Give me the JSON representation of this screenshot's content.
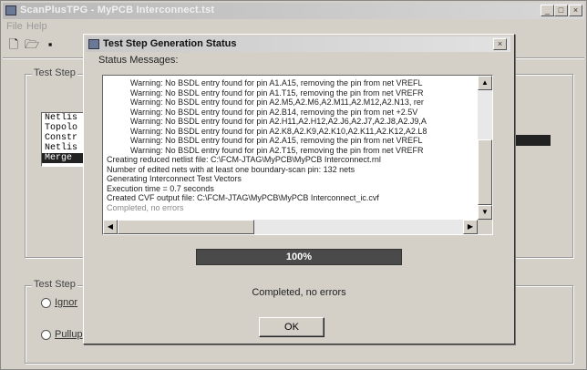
{
  "app": {
    "title": "ScanPlusTPG - MyPCB Interconnect.tst"
  },
  "menu": [
    "File",
    "Help"
  ],
  "toolbar": {
    "icons": [
      "new-icon",
      "open-icon",
      "save-icon"
    ]
  },
  "main": {
    "group1_label": "Test Step",
    "list_items": [
      "Netlis",
      "Topolo",
      "Constr",
      "Netlis",
      "Merge"
    ],
    "selected_index": 4,
    "group2_label": "Test Step",
    "radio1": "Ignor",
    "radio2": "Pullup"
  },
  "dialog": {
    "title": "Test Step Generation Status",
    "status_label": "Status Messages:",
    "messages": [
      {
        "text": "Warning: No BSDL entry found for pin A1.A15, removing the pin from net VREFL",
        "indent": true
      },
      {
        "text": "Warning: No BSDL entry found for pin A1.T15, removing the pin from net VREFR",
        "indent": true
      },
      {
        "text": "Warning: No BSDL entry found for pin A2.M5,A2.M6,A2.M11,A2.M12,A2.N13, rer",
        "indent": true
      },
      {
        "text": "Warning: No BSDL entry found for pin A2.B14, removing the pin from net +2.5V",
        "indent": true
      },
      {
        "text": "Warning: No BSDL entry found for pin A2.H11,A2.H12,A2.J6,A2.J7,A2.J8,A2.J9,A",
        "indent": true
      },
      {
        "text": "Warning: No BSDL entry found for pin A2.K8,A2.K9,A2.K10,A2.K11,A2.K12,A2.L8",
        "indent": true
      },
      {
        "text": "Warning: No BSDL entry found for pin A2.A15, removing the pin from net VREFL",
        "indent": true
      },
      {
        "text": "Warning: No BSDL entry found for pin A2.T15, removing the pin from net VREFR",
        "indent": true
      },
      {
        "text": "Creating reduced netlist file: C:\\FCM-JTAG\\MyPCB\\MyPCB Interconnect.rnl",
        "indent": false
      },
      {
        "text": "Number of edited nets with at least one boundary-scan pin: 132 nets",
        "indent": false
      },
      {
        "text": "Generating Interconnect Test Vectors",
        "indent": false
      },
      {
        "text": "Execution time = 0.7 seconds",
        "indent": false
      },
      {
        "text": "Created CVF output file: C:\\FCM-JTAG\\MyPCB\\MyPCB Interconnect_ic.cvf",
        "indent": false
      },
      {
        "text": "Completed, no errors",
        "indent": false,
        "gray": true
      }
    ],
    "progress_value": 100,
    "progress_text": "100%",
    "completion_text": "Completed, no errors",
    "ok_label": "OK"
  }
}
